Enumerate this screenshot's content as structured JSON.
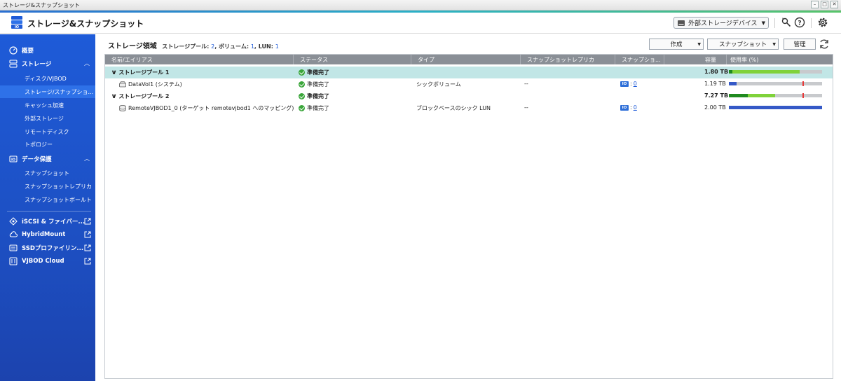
{
  "window": {
    "title": "ストレージ&スナップショット",
    "buttons": [
      "–",
      "□",
      "✕"
    ]
  },
  "header": {
    "app_title": "ストレージ&スナップショット",
    "external_device_label": "外部ストレージデバイス"
  },
  "sidebar": {
    "overview": "概要",
    "storage": "ストレージ",
    "storage_items": [
      "ディスク/VJBOD",
      "ストレージ/スナップショ...",
      "キャッシュ加速",
      "外部ストレージ",
      "リモートディスク",
      "トポロジー"
    ],
    "data_protection": "データ保護",
    "data_protection_items": [
      "スナップショット",
      "スナップショットレプリカ",
      "スナップショットボールト"
    ],
    "external_apps": [
      "iSCSI & ファイバー...",
      "HybridMount",
      "SSDプロファイリン...",
      "VJBOD Cloud"
    ]
  },
  "main": {
    "section_title": "ストレージ領域",
    "meta_pool_label": "ストレージプール:",
    "meta_pool_count": "2",
    "meta_volume_label": ", ボリューム:",
    "meta_volume_count": "1",
    "meta_lun_label": ", LUN:",
    "meta_lun_count": "1",
    "toolbar": {
      "create": "作成",
      "snapshot": "スナップショット",
      "manage": "管理"
    },
    "columns": [
      "名前/エイリアス",
      "ステータス",
      "タイプ",
      "スナップショットレプリカ",
      "スナップショ...",
      "容量",
      "使用率 (%)"
    ],
    "rows": [
      {
        "name": "ストレージプール 1",
        "status": "準備完了",
        "type": "",
        "replica": "",
        "snapshot": "",
        "capacity": "1.80 TB",
        "usage": {
          "used": 0.04,
          "second": 0.72,
          "marker": null
        }
      },
      {
        "name": "DataVol1 (システム)",
        "status": "準備完了",
        "type": "シックボリューム",
        "replica": "--",
        "snapshot": "0",
        "capacity": "1.19 TB",
        "usage": {
          "used": 0.08,
          "second": 0,
          "marker": 0.79
        }
      },
      {
        "name": "ストレージプール 2",
        "status": "準備完了",
        "type": "",
        "replica": "",
        "snapshot": "",
        "capacity": "7.27 TB",
        "usage": {
          "used": 0.2,
          "second": 0.29,
          "marker": 0.79
        }
      },
      {
        "name": "RemoteVJBOD1_0 (ターゲット remotevjbod1 へのマッピング)",
        "status": "準備完了",
        "type": "ブロックベースのシック LUN",
        "replica": "--",
        "snapshot": "0",
        "capacity": "2.00 TB",
        "usage": {
          "used": 1.0,
          "second": 0,
          "marker": null
        }
      }
    ],
    "snapshot_badge_text": "IO"
  },
  "colors": {
    "sidebar": "#1e5bd8",
    "accent_blue": "#2e6fd8",
    "ok_green": "#3aa63a",
    "selected_row": "#c1e6e6"
  }
}
